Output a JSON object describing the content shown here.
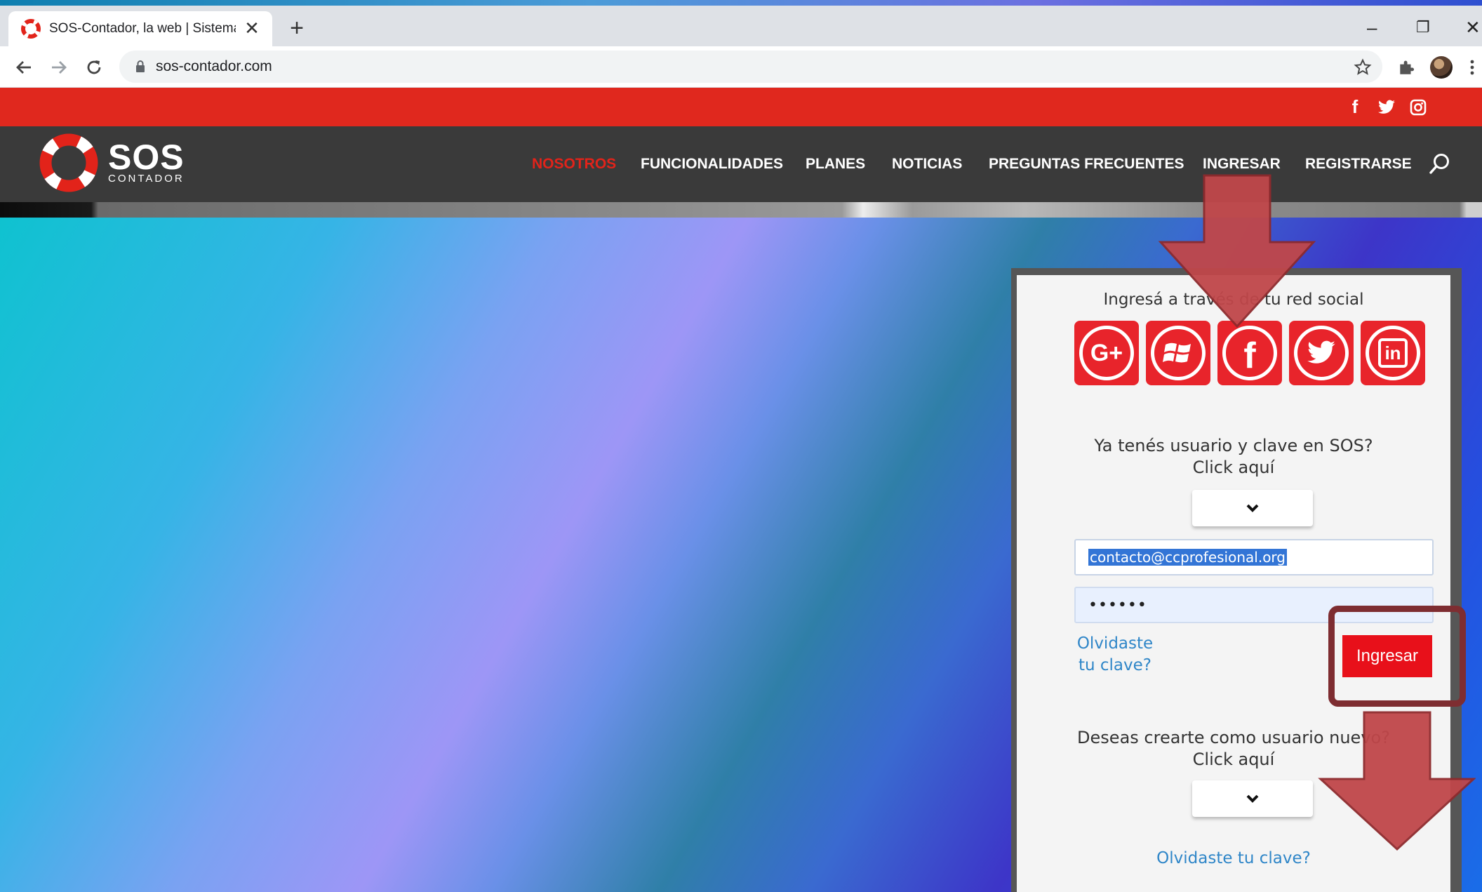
{
  "browser": {
    "tab_title": "SOS-Contador, la web | Sistema",
    "tab_close": "✕",
    "new_tab": "+",
    "url": "sos-contador.com",
    "window_controls": {
      "minimize": "–",
      "restore": "❐",
      "close": "✕"
    }
  },
  "site": {
    "logo": {
      "big": "SOS",
      "small": "CONTADOR"
    },
    "social_top": [
      "f",
      "t",
      "ig"
    ],
    "menu": [
      {
        "label": "NOSOTROS",
        "active": true
      },
      {
        "label": "FUNCIONALIDADES",
        "active": false
      },
      {
        "label": "PLANES",
        "active": false
      },
      {
        "label": "NOTICIAS",
        "active": false
      },
      {
        "label": "PREGUNTAS FRECUENTES",
        "active": false
      },
      {
        "label": "INGRESAR",
        "active": false
      },
      {
        "label": "REGISTRARSE",
        "active": false
      }
    ]
  },
  "login": {
    "social_title": "Ingresá a través de tu red social",
    "social_buttons": [
      "google-plus",
      "windows",
      "facebook",
      "twitter",
      "linkedin"
    ],
    "existing_q1": "Ya tenés usuario y clave en SOS?",
    "existing_q2": "Click aquí",
    "email_value": "contacto@ccprofesional.org",
    "password_dots": "••••••",
    "forgot_line1": "Olvidaste",
    "forgot_line2": "tu clave?",
    "login_button": "Ingresar",
    "new_q1": "Deseas crearte como usuario nuevo?",
    "new_q2": "Click aquí",
    "forgot_bottom": "Olvidaste tu clave?"
  },
  "colors": {
    "brand_red": "#e0281e",
    "nav_dark": "#3a3a3a",
    "annotation_arrow": "#c0474a",
    "annotation_box": "#7e2d31",
    "link_blue": "#2f86c8"
  }
}
